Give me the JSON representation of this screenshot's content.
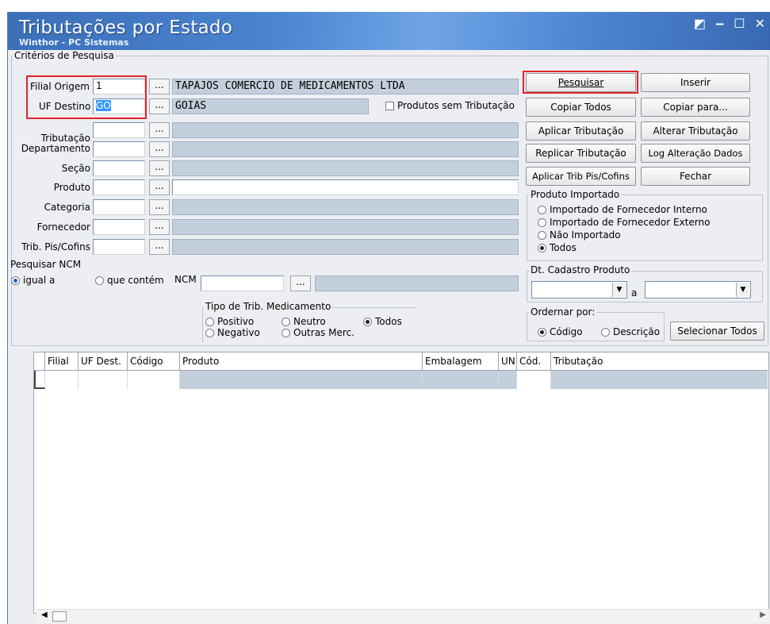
{
  "window": {
    "title": "Tributações por Estado",
    "subtitle": "Winthor - PC Sistemas",
    "controls": [
      "◩",
      "‒",
      "☐",
      "✕"
    ]
  },
  "criteria": {
    "group_title": "Critérios de Pesquisa",
    "filial_origem": {
      "label": "Filial Origem",
      "value": "1",
      "description": "TAPAJOS COMERCIO DE MEDICAMENTOS LTDA"
    },
    "uf_destino": {
      "label": "UF Destino",
      "value": "GO",
      "description": "GOIAS"
    },
    "produtos_sem_tributacao": "Produtos sem Tributação",
    "tributacao": {
      "label": "Tributação",
      "value": "",
      "description": ""
    },
    "departamento": {
      "label": "Departamento",
      "value": "",
      "description": ""
    },
    "secao": {
      "label": "Seção",
      "value": "",
      "description": ""
    },
    "produto": {
      "label": "Produto",
      "value": "",
      "description": ""
    },
    "categoria": {
      "label": "Categoria",
      "value": "",
      "description": ""
    },
    "fornecedor": {
      "label": "Fornecedor",
      "value": "",
      "description": ""
    },
    "trib_pis_cofins": {
      "label": "Trib. Pis/Cofins",
      "value": "",
      "description": ""
    },
    "ellipsis": "...",
    "pesquisar_ncm": {
      "title": "Pesquisar NCM",
      "options": [
        "igual a",
        "que contém"
      ],
      "selected": "igual a"
    },
    "ncm": {
      "label": "NCM",
      "value": "",
      "description": ""
    },
    "tipo_trib_medicamento": {
      "title": "Tipo de Trib. Medicamento",
      "options": [
        "Positivo",
        "Neutro",
        "Todos",
        "Negativo",
        "Outras Merc."
      ],
      "selected": "Todos"
    }
  },
  "buttons": {
    "pesquisar": "Pesquisar",
    "inserir": "Inserir",
    "copiar_todos": "Copiar Todos",
    "copiar_para": "Copiar para...",
    "aplicar_tributacao": "Aplicar Tributação",
    "alterar_tributacao": "Alterar Tributação",
    "replicar_tributacao": "Replicar Tributação",
    "log_alteracao": "Log Alteração Dados",
    "aplicar_trib_pis": "Aplicar Trib Pis/Cofins",
    "fechar": "Fechar",
    "selecionar_todos": "Selecionar Todos"
  },
  "produto_importado": {
    "title": "Produto Importado",
    "options": [
      "Importado de Fornecedor Interno",
      "Importado de Fornecedor Externo",
      "Não Importado",
      "Todos"
    ],
    "selected": "Todos"
  },
  "dt_cadastro": {
    "title": "Dt. Cadastro Produto",
    "separator": "a",
    "from": "",
    "to": ""
  },
  "ordenar": {
    "title": "Ordernar por:",
    "options": [
      "Código",
      "Descrição"
    ],
    "selected": "Código"
  },
  "grid": {
    "columns": [
      "Filial",
      "UF Dest.",
      "Código",
      "Produto",
      "Embalagem",
      "UN",
      "Cód.",
      "Tributação"
    ]
  },
  "colors": {
    "title_bar": "#4b84cf",
    "highlight": "#e2232b",
    "readonly_field": "#c3cfdc"
  }
}
